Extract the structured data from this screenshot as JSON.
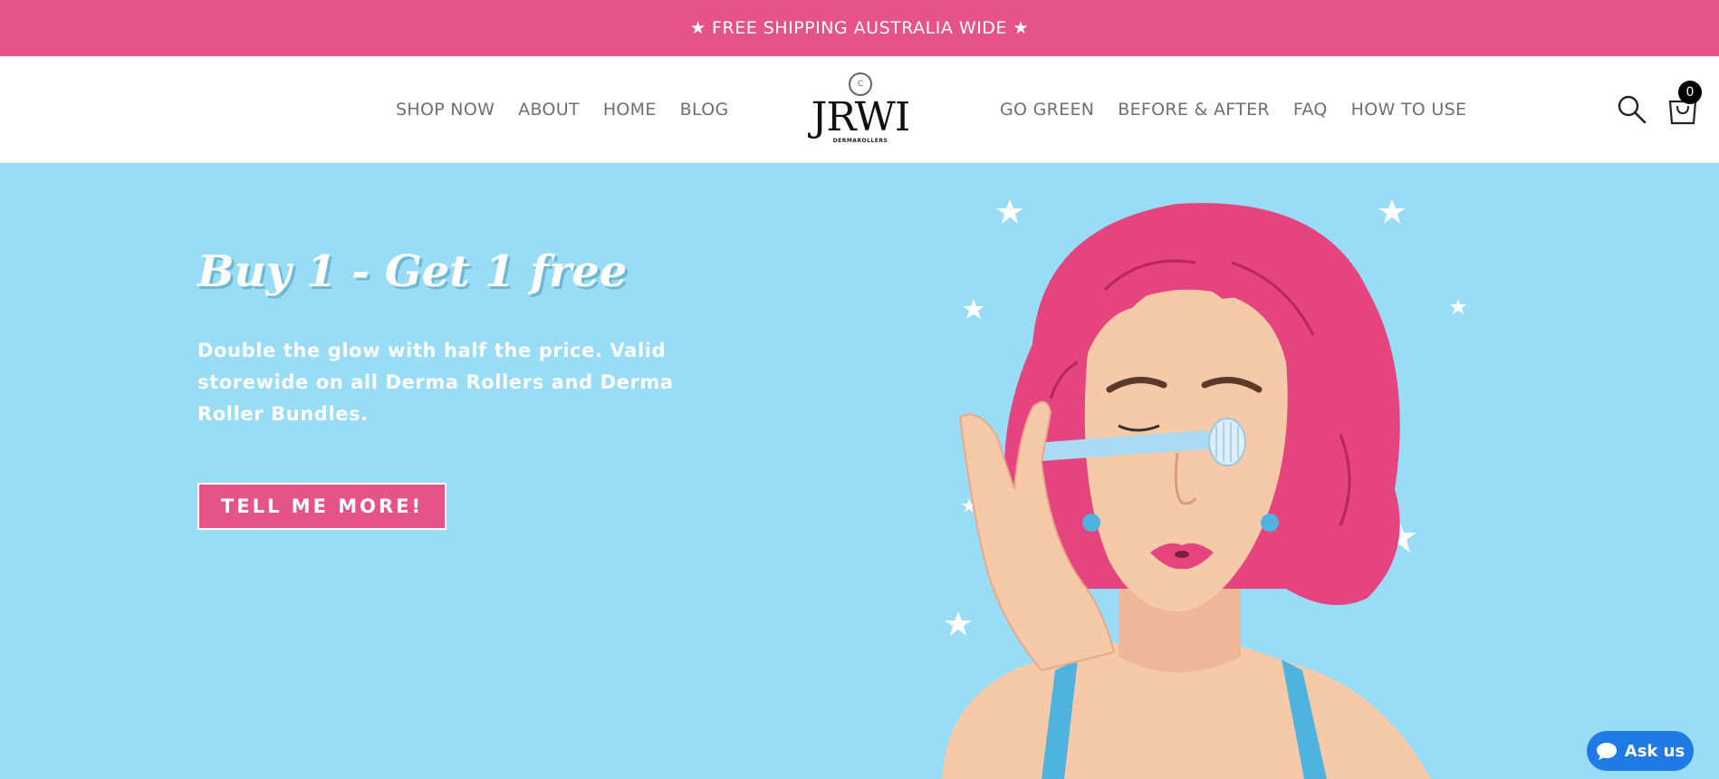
{
  "announcement": {
    "text": "★ FREE SHIPPING AUSTRALIA WIDE ★"
  },
  "nav": {
    "left": [
      {
        "label": "SHOP NOW"
      },
      {
        "label": "ABOUT"
      },
      {
        "label": "HOME"
      },
      {
        "label": "BLOG"
      }
    ],
    "right": [
      {
        "label": "GO GREEN"
      },
      {
        "label": "BEFORE & AFTER"
      },
      {
        "label": "FAQ"
      },
      {
        "label": "HOW TO USE"
      }
    ]
  },
  "logo": {
    "mark": "C",
    "wordmark": "JRWI",
    "tagline": "DERMAROLLERS"
  },
  "header_icons": {
    "search": "search-icon",
    "cart": "shopping-bag-icon",
    "cart_count": "0"
  },
  "hero": {
    "title": "Buy 1 - Get 1 free",
    "text": "Double the glow with half the price. Valid storewide on all Derma Rollers and Derma Roller Bundles.",
    "cta": "TELL ME MORE!",
    "illustration": "woman-with-derma-roller-illustration"
  },
  "chat": {
    "label": "Ask us",
    "icon": "chat-bubble-icon"
  },
  "colors": {
    "brand_pink": "#e55388",
    "hero_blue": "#99dcf5",
    "hair_pink": "#e5447f",
    "skin": "#f6c9a8",
    "chat_blue": "#1f7ae6"
  }
}
